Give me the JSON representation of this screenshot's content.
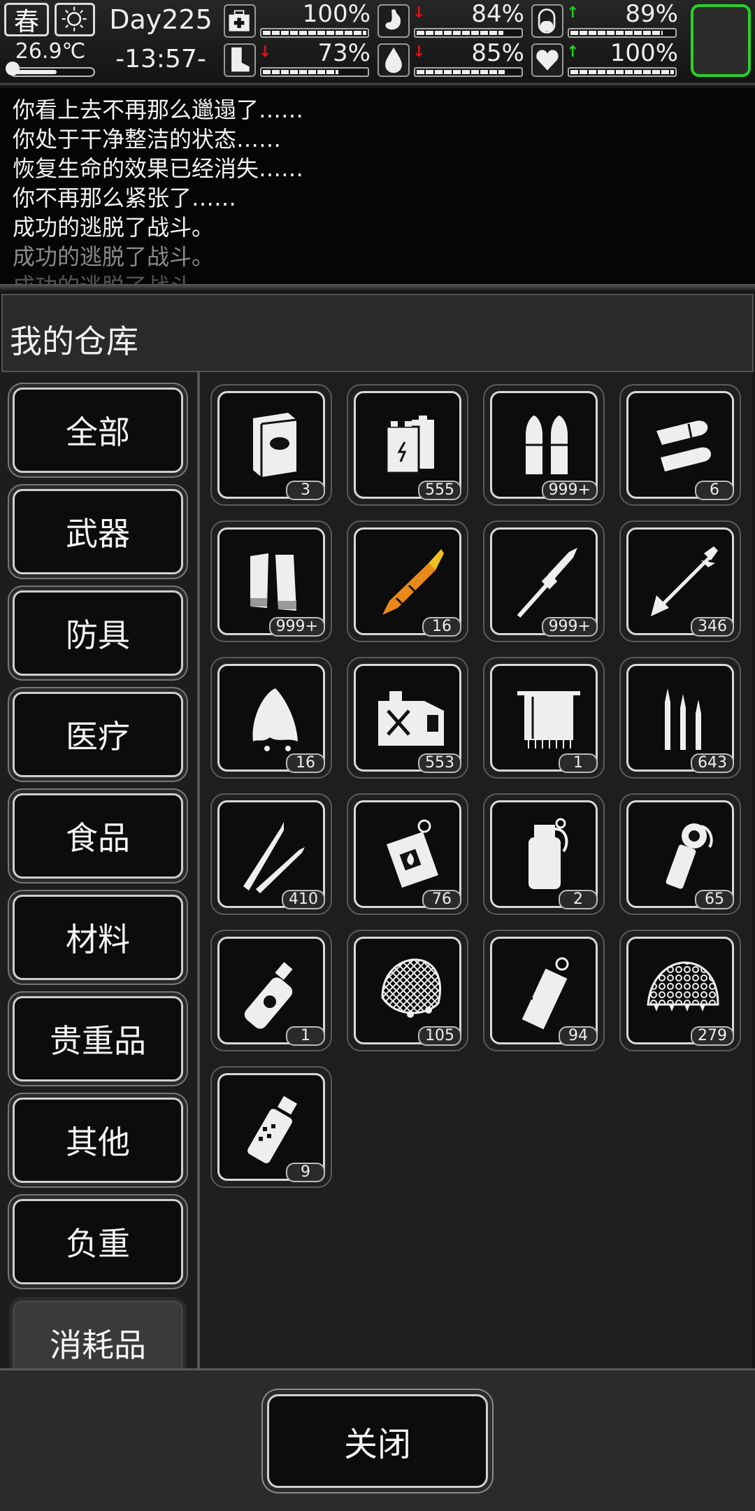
{
  "hud": {
    "season": "春",
    "weather_icon": "sun-icon",
    "temperature": "26.9℃",
    "temperature_level": 0.55,
    "day": "Day225",
    "time": "-13:57-",
    "stats": [
      {
        "name": "health",
        "icon": "first-aid-kit-icon",
        "trend": "",
        "value": "100%",
        "level": 1.0
      },
      {
        "name": "hunger",
        "icon": "stomach-icon",
        "trend": "down",
        "value": "84%",
        "level": 0.84
      },
      {
        "name": "medicine",
        "icon": "pill-icon",
        "trend": "up",
        "value": "89%",
        "level": 0.89
      },
      {
        "name": "stamina",
        "icon": "boot-icon",
        "trend": "down",
        "value": "73%",
        "level": 0.73
      },
      {
        "name": "thirst",
        "icon": "water-drop-icon",
        "trend": "down",
        "value": "85%",
        "level": 0.85
      },
      {
        "name": "mood",
        "icon": "heart-icon",
        "trend": "up",
        "value": "100%",
        "level": 1.0
      }
    ]
  },
  "log": [
    "你看上去不再那么邋遢了……",
    "你处于干净整洁的状态……",
    "恢复生命的效果已经消失……",
    "你不再那么紧张了……",
    "成功的逃脱了战斗。",
    "成功的逃脱了战斗。",
    "成功的逃脱了战斗。"
  ],
  "warehouse": {
    "title": "我的仓库"
  },
  "categories": [
    "全部",
    "武器",
    "防具",
    "医疗",
    "食品",
    "材料",
    "贵重品",
    "其他",
    "负重",
    "消耗品"
  ],
  "items": [
    {
      "icon": "book-icon",
      "qty": "3"
    },
    {
      "icon": "battery-icon",
      "qty": "555"
    },
    {
      "icon": "pistol-bullets-icon",
      "qty": "999+"
    },
    {
      "icon": "shotgun-slug-icon",
      "qty": "6"
    },
    {
      "icon": "shotgun-shells-icon",
      "qty": "999+"
    },
    {
      "icon": "rocket-icon",
      "qty": "16"
    },
    {
      "icon": "rpg-rocket-icon",
      "qty": "999+"
    },
    {
      "icon": "arrow-icon",
      "qty": "346"
    },
    {
      "icon": "rag-icon",
      "qty": "16"
    },
    {
      "icon": "fuel-can-icon",
      "qty": "553"
    },
    {
      "icon": "towel-icon",
      "qty": "1"
    },
    {
      "icon": "rifle-rounds-icon",
      "qty": "643"
    },
    {
      "icon": "sniper-rounds-icon",
      "qty": "410"
    },
    {
      "icon": "incendiary-grenade-icon",
      "qty": "76"
    },
    {
      "icon": "smoke-grenade-icon",
      "qty": "2"
    },
    {
      "icon": "stick-grenade-icon",
      "qty": "65"
    },
    {
      "icon": "toxic-spray-icon",
      "qty": "1"
    },
    {
      "icon": "net-icon",
      "qty": "105"
    },
    {
      "icon": "flashbang-icon",
      "qty": "94"
    },
    {
      "icon": "camo-net-icon",
      "qty": "279"
    },
    {
      "icon": "frag-grenade-icon",
      "qty": "9"
    }
  ],
  "close_label": "关闭"
}
